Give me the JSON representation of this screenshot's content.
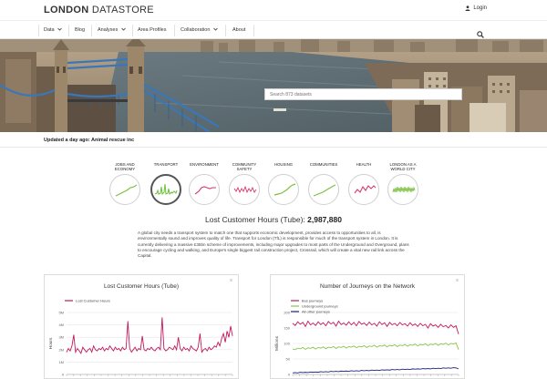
{
  "brand": {
    "name_bold": "LONDON",
    "name_light": "DATASTORE"
  },
  "header": {
    "login_label": "Login"
  },
  "nav": {
    "items": [
      {
        "label": "Data",
        "dropdown": true
      },
      {
        "label": "Blog",
        "dropdown": false
      },
      {
        "label": "Analyses",
        "dropdown": true
      },
      {
        "label": "Area Profiles",
        "dropdown": false
      },
      {
        "label": "Collaboration",
        "dropdown": true
      },
      {
        "label": "About",
        "dropdown": false
      }
    ]
  },
  "hero": {
    "search_placeholder": "Search 873 datasets"
  },
  "updated": {
    "text": "Updated a day ago: Animal rescue inc"
  },
  "themes": [
    {
      "label": "JOBS AND ECONOMY",
      "active": false
    },
    {
      "label": "TRANSPORT",
      "active": true
    },
    {
      "label": "ENVIRONMENT",
      "active": false
    },
    {
      "label": "COMMUNITY SAFETY",
      "active": false
    },
    {
      "label": "HOUSING",
      "active": false
    },
    {
      "label": "COMMUNITIES",
      "active": false
    },
    {
      "label": "HEALTH",
      "active": false
    },
    {
      "label": "LONDON AS A WORLD CITY",
      "active": false
    }
  ],
  "metric": {
    "label": "Lost Customer Hours (Tube):",
    "value": "2,987,880"
  },
  "description": "A global city needs a transport system to match one that supports economic development, provides access to opportunities to all, is environmentally sound and improves quality of life. Transport for London (TfL) is responsible for much of the transport system in London. It is currently delivering a massive £35bn scheme of improvements, including major upgrades to most parts of the Underground and Overground, plans to encourage cycling and walking, and Europe's single biggest rail construction project, Crossrail, which will create a vital new rail link across the Capital.",
  "colors": {
    "accent": "#c2185b",
    "green": "#8bc34a",
    "navy": "#1a237e",
    "text": "#333333"
  },
  "chart_data": [
    {
      "type": "line",
      "title": "Lost Customer Hours (Tube)",
      "ylabel": "Hours",
      "ylim": [
        0,
        5
      ],
      "yticks": [
        0,
        1,
        2,
        3,
        4,
        5
      ],
      "ytick_labels": [
        "0",
        "1M",
        "2M",
        "3M",
        "4M",
        "5M"
      ],
      "series": [
        {
          "name": "Lost Customer Hours",
          "color": "#c2185b",
          "values": [
            1.8,
            2.1,
            1.9,
            2.3,
            3.2,
            1.8,
            2.1,
            1.9,
            1.7,
            2.2,
            2.0,
            1.8,
            2.0,
            2.1,
            1.8,
            2.3,
            2.0,
            1.9,
            2.1,
            2.0,
            2.2,
            1.9,
            2.1,
            2.0,
            2.3,
            2.1,
            1.9,
            2.2,
            2.0,
            2.1,
            1.9,
            2.2,
            2.0,
            2.1,
            4.3,
            2.1,
            1.8,
            2.0,
            2.2,
            1.9,
            2.1,
            2.0,
            3.1,
            2.0,
            1.9,
            2.1,
            2.0,
            2.2,
            2.0,
            1.9,
            2.1,
            2.2,
            2.0,
            4.6,
            2.1,
            1.9,
            2.0,
            2.2,
            2.1,
            2.0,
            2.3,
            2.0,
            3.0,
            2.1,
            1.9,
            2.2,
            2.0,
            2.1,
            1.9,
            2.3,
            2.1,
            2.0,
            1.9,
            2.2,
            3.3,
            1.8,
            2.0,
            2.1,
            1.9,
            2.2,
            2.0,
            2.1,
            2.3,
            2.2,
            2.6,
            2.3,
            2.9,
            3.3,
            2.6,
            3.5,
            3.0,
            3.9,
            3.1
          ]
        }
      ]
    },
    {
      "type": "line",
      "title": "Number of Journeys on the Network",
      "ylabel": "Millions",
      "ylim": [
        0,
        200
      ],
      "yticks": [
        0,
        50,
        100,
        150,
        200
      ],
      "ytick_labels": [
        "0",
        "50",
        "100",
        "150",
        "200"
      ],
      "series": [
        {
          "name": "Bus journeys",
          "color": "#c2185b",
          "values": [
            165,
            158,
            170,
            162,
            168,
            155,
            172,
            160,
            166,
            158,
            170,
            161,
            167,
            157,
            171,
            163,
            168,
            156,
            172,
            161,
            166,
            159,
            170,
            160,
            168,
            157,
            171,
            162,
            166,
            158,
            169,
            160,
            165,
            156,
            170,
            161,
            167,
            155,
            168,
            160,
            165,
            157,
            168,
            160,
            164,
            156,
            167,
            158,
            163,
            155,
            165,
            157,
            162,
            150,
            164,
            156,
            160,
            152,
            162,
            154,
            158,
            150,
            160,
            152,
            157,
            130
          ]
        },
        {
          "name": "Underground journeys",
          "color": "#8bc34a",
          "values": [
            82,
            80,
            85,
            83,
            87,
            81,
            86,
            84,
            88,
            82,
            87,
            85,
            89,
            83,
            88,
            86,
            90,
            84,
            89,
            87,
            91,
            85,
            90,
            88,
            92,
            86,
            91,
            89,
            93,
            87,
            92,
            90,
            94,
            88,
            93,
            91,
            95,
            89,
            94,
            92,
            96,
            90,
            95,
            93,
            97,
            91,
            96,
            94,
            98,
            92,
            97,
            95,
            99,
            93,
            98,
            96,
            100,
            94,
            99,
            97,
            101,
            95,
            100,
            98,
            102,
            80
          ]
        },
        {
          "name": "All other journeys",
          "color": "#1a237e",
          "values": [
            5,
            6,
            5,
            7,
            6,
            7,
            6,
            8,
            7,
            8,
            7,
            9,
            8,
            9,
            8,
            10,
            9,
            10,
            9,
            11,
            10,
            11,
            10,
            12,
            11,
            12,
            11,
            13,
            12,
            13,
            12,
            14,
            13,
            14,
            13,
            15,
            14,
            15,
            14,
            16,
            15,
            16,
            15,
            17,
            16,
            17,
            16,
            18,
            17,
            18,
            17,
            19,
            18,
            19,
            18,
            20,
            19,
            20,
            19,
            21,
            20,
            21,
            20,
            22,
            21,
            18
          ]
        }
      ]
    }
  ]
}
